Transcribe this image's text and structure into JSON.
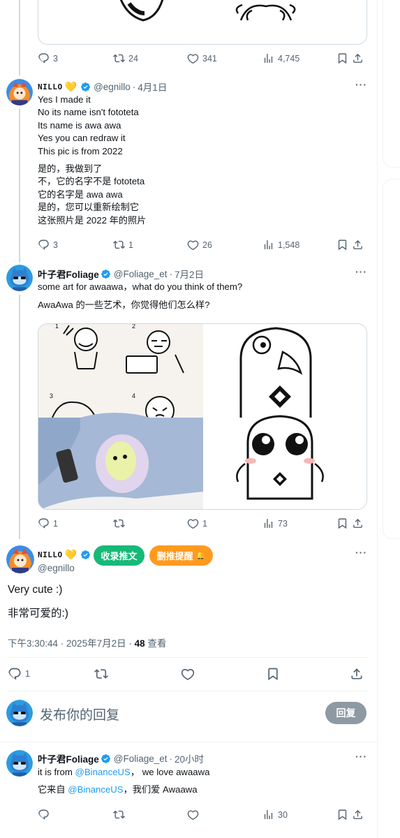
{
  "tweet_top": {
    "actions": {
      "replies": "3",
      "retweets": "24",
      "likes": "341",
      "views": "4,745"
    }
  },
  "tweet_nillo": {
    "name": "NILLO",
    "heart": "💛",
    "handle": "@egnillo",
    "date": "4月1日",
    "text_en": "Yes I made it\nNo its name isn't fototeta\nIts name is awa awa\nYes you can redraw it\nThis pic is from 2022",
    "text_zh": "是的，我做到了\n不，它的名字不是 fototeta\n它的名字是 awa awa\n是的，您可以重新绘制它\n这张照片是 2022 年的照片",
    "actions": {
      "replies": "3",
      "retweets": "1",
      "likes": "26",
      "views": "1,548"
    }
  },
  "tweet_foliage": {
    "name": "叶子君Foliage",
    "handle": "@Foliage_et",
    "date": "7月2日",
    "text_en": "some art for awaawa，what do you think of them?",
    "text_zh": "AwaAwa 的一些艺术，你觉得他们怎么样?",
    "grid_labels": [
      "1",
      "2",
      "3",
      "4"
    ],
    "actions": {
      "replies": "1",
      "retweets": "",
      "likes": "1",
      "views": "73"
    }
  },
  "main_tweet": {
    "name": "NILLO",
    "heart": "💛",
    "handle": "@egnillo",
    "btn_collect": "收录推文",
    "btn_delete": "删推提醒",
    "text_en": "Very cute :)",
    "text_zh": "非常可爱的:)",
    "time": "下午3:30:44 · 2025年7月2日 ·",
    "views": "48",
    "views_label": "查看",
    "actions": {
      "replies": "1"
    }
  },
  "composer": {
    "placeholder": "发布你的回复",
    "reply_button": "回复"
  },
  "reply_foliage": {
    "name": "叶子君Foliage",
    "handle": "@Foliage_et",
    "date": "20小时",
    "text_en_pre": "it is from ",
    "mention": "@BinanceUS",
    "text_en_post": "， we love awaawa",
    "text_zh_pre": "它来自 ",
    "text_zh_post": "，我们爱 Awaawa",
    "actions": {
      "views": "30"
    }
  },
  "colors": {
    "accent": "#1d9bf0",
    "green_button": "#17b978",
    "orange_button": "#ff9a1f",
    "binance_yellow": "#f0b90b"
  }
}
